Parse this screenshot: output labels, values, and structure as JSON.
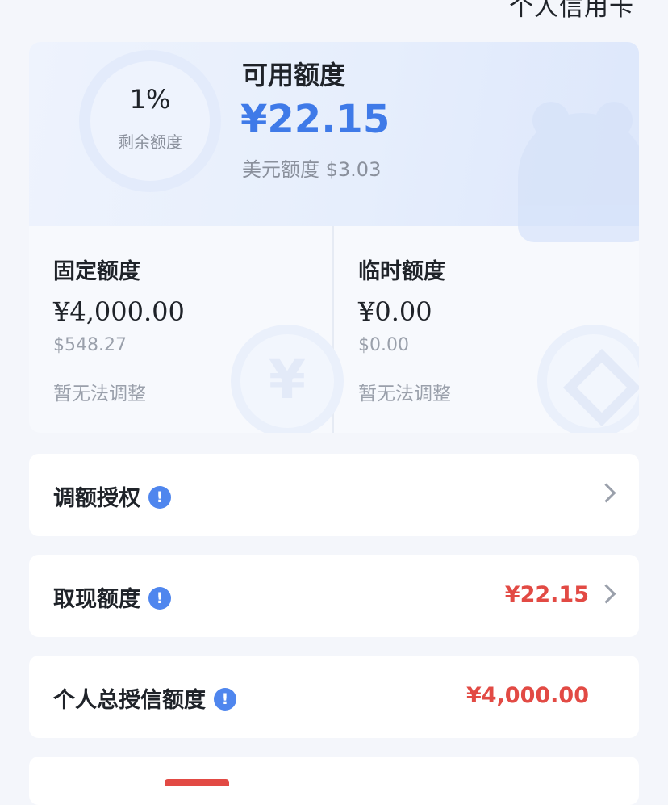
{
  "header": {
    "title": "个人信用卡"
  },
  "summary": {
    "remaining_percent": "1%",
    "remaining_label": "剩余额度",
    "available_title": "可用额度",
    "available_amount": "¥22.15",
    "usd_line": "美元额度 $3.03"
  },
  "quotas": [
    {
      "title": "固定额度",
      "amount": "¥4,000.00",
      "usd": "$548.27",
      "note": "暂无法调整"
    },
    {
      "title": "临时额度",
      "amount": "¥0.00",
      "usd": "$0.00",
      "note": "暂无法调整"
    }
  ],
  "rows": [
    {
      "label": "调额授权",
      "value": ""
    },
    {
      "label": "取现额度",
      "value": "¥22.15"
    },
    {
      "label": "个人总授信额度",
      "value": "¥4,000.00"
    }
  ],
  "icons": {
    "info": "!",
    "currency": "¥"
  },
  "colors": {
    "accent_blue": "#3f7ae8",
    "amount_red": "#e24a44",
    "info_blue": "#4f86ee"
  }
}
